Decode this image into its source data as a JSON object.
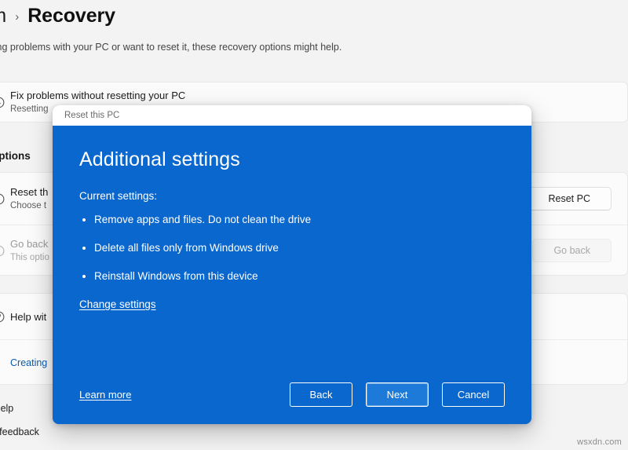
{
  "page": {
    "breadcrumb": {
      "parent": "stem",
      "separator": "›",
      "current": "Recovery"
    },
    "subtitle": "re having problems with your PC or want to reset it, these recovery options might help.",
    "section_heading": "ery options",
    "rows": [
      {
        "icon": "wrench-icon",
        "title": "Fix problems without resetting your PC",
        "subtitle": "Resetting",
        "action": null
      },
      {
        "icon": "reset-icon",
        "title": "Reset th",
        "subtitle": "Choose t",
        "action": "Reset PC",
        "action_disabled": false
      },
      {
        "icon": "goback-icon",
        "title": "Go back",
        "subtitle": "This optio",
        "action": "Go back",
        "action_disabled": true
      },
      {
        "icon": "help-icon",
        "title": "Help wit",
        "subtitle": null,
        "action": null
      }
    ],
    "link_row": "Creating",
    "footer_links": [
      "Get help",
      "Give feedback"
    ],
    "watermark": "wsxdn.com"
  },
  "dialog": {
    "titlebar": "Reset this PC",
    "heading": "Additional settings",
    "current_settings_label": "Current settings:",
    "settings": [
      "Remove apps and files. Do not clean the drive",
      "Delete all files only from Windows drive",
      "Reinstall Windows from this device"
    ],
    "change_settings_link": "Change settings",
    "learn_more_link": "Learn more",
    "buttons": {
      "back": "Back",
      "next": "Next",
      "cancel": "Cancel"
    },
    "colors": {
      "background": "#0a67ce",
      "primary_button": "#1d7ad8",
      "text": "#ffffff"
    }
  }
}
